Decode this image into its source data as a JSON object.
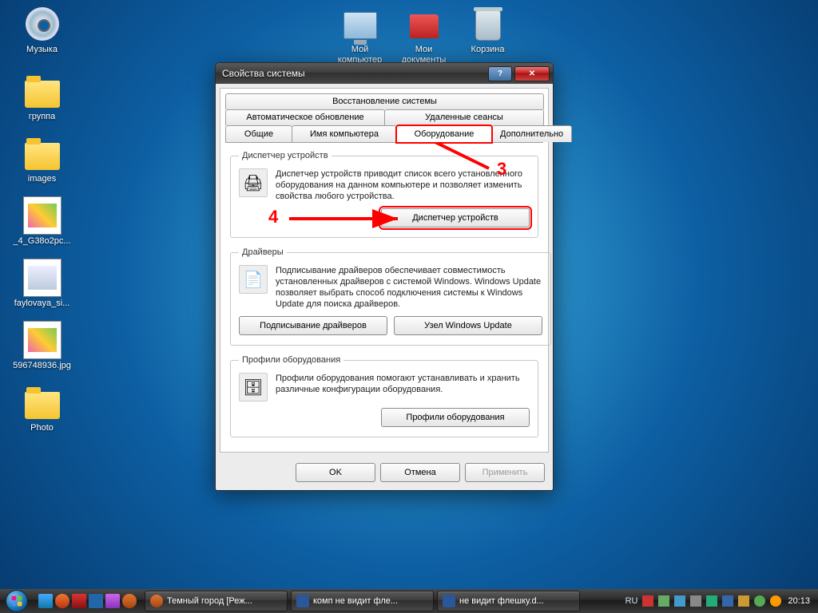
{
  "desktop_icons": {
    "music": "Музыка",
    "mycomputer": "Мой\nкомпьютер",
    "mydocs": "Мои\nдокументы",
    "recycle": "Корзина",
    "gruppa": "группа",
    "images": "images",
    "thumb1": "_4_G38o2pc...",
    "thumb2": "faylovaya_si...",
    "thumb3": "596748936.jpg",
    "photo": "Photo"
  },
  "dialog": {
    "title": "Свойства системы",
    "tabs": {
      "restore": "Восстановление системы",
      "autoupdate": "Автоматическое обновление",
      "remote": "Удаленные сеансы",
      "general": "Общие",
      "compname": "Имя компьютера",
      "hardware": "Оборудование",
      "advanced": "Дополнительно"
    },
    "groups": {
      "devmgr": {
        "legend": "Диспетчер устройств",
        "text": "Диспетчер устройств приводит список всего установленного оборудования на данном компьютере и позволяет изменить свойства любого устройства.",
        "button": "Диспетчер устройств"
      },
      "drivers": {
        "legend": "Драйверы",
        "text": "Подписывание драйверов обеспечивает совместимость установленных драйверов с системой Windows.  Windows Update позволяет выбрать способ подключения системы к Windows Update для поиска драйверов.",
        "btn_sign": "Подписывание драйверов",
        "btn_wu": "Узел Windows Update"
      },
      "profiles": {
        "legend": "Профили оборудования",
        "text": "Профили оборудования помогают устанавливать и хранить различные конфигурации оборудования.",
        "button": "Профили оборудования"
      }
    },
    "footer": {
      "ok": "OK",
      "cancel": "Отмена",
      "apply": "Применить"
    }
  },
  "annotations": {
    "num3": "3",
    "num4": "4"
  },
  "taskbar": {
    "tasks": {
      "t1": "Темный город [Реж...",
      "t2": "комп не видит фле...",
      "t3": "не видит флешку.d..."
    },
    "lang": "RU",
    "clock": "20:13"
  }
}
